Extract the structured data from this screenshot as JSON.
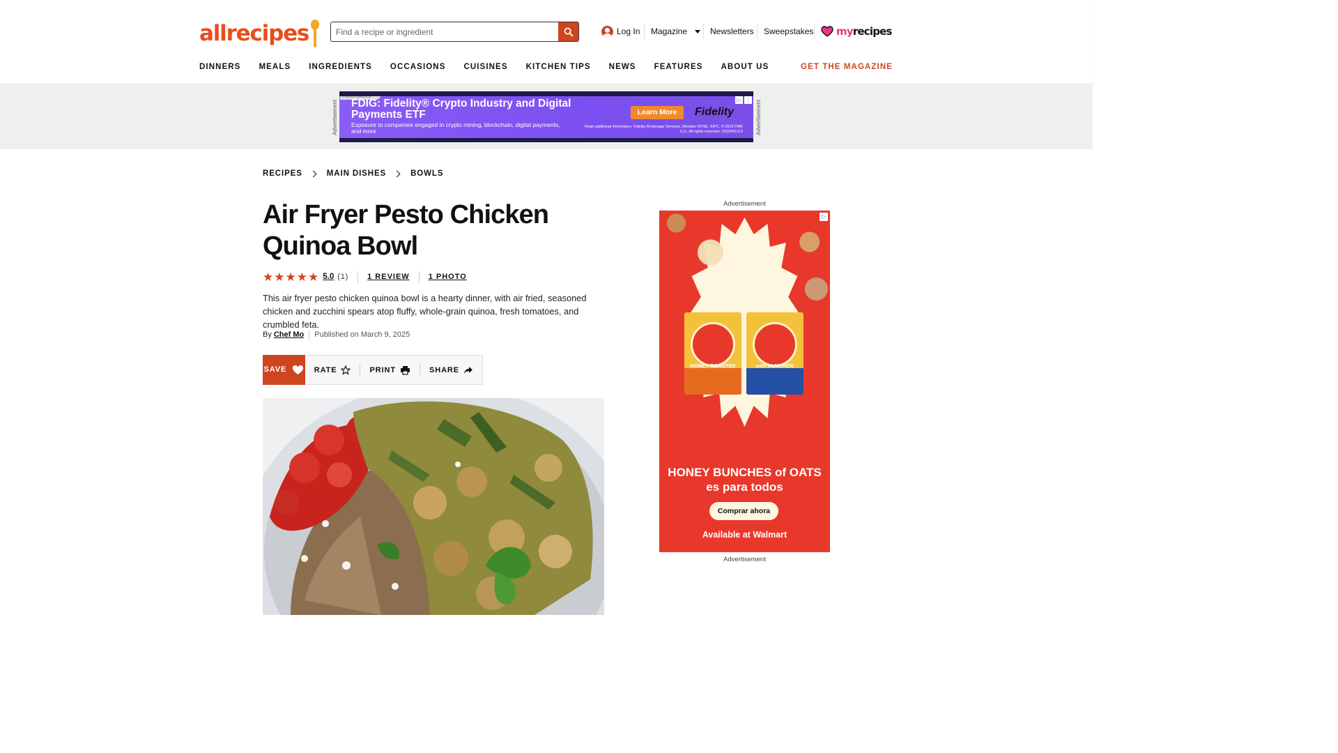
{
  "header": {
    "logo_text": "allrecipes",
    "search_placeholder": "Find a recipe or ingredient",
    "login_label": "Log In",
    "magazine_label": "Magazine",
    "newsletters_label": "Newsletters",
    "sweepstakes_label": "Sweepstakes",
    "myrecipes_my": "my",
    "myrecipes_recipes": "recipes",
    "brand_color": "#ce4620"
  },
  "nav": {
    "items": [
      {
        "label": "DINNERS"
      },
      {
        "label": "MEALS"
      },
      {
        "label": "INGREDIENTS"
      },
      {
        "label": "OCCASIONS"
      },
      {
        "label": "CUISINES"
      },
      {
        "label": "KITCHEN TIPS"
      },
      {
        "label": "NEWS"
      },
      {
        "label": "FEATURES"
      },
      {
        "label": "ABOUT US"
      }
    ],
    "get_magazine_label": "GET THE MAGAZINE"
  },
  "top_ad": {
    "side_label": "Advertisement",
    "adchoices_label": "AdChoices",
    "headline": "FDIG: Fidelity® Crypto Industry and Digital Payments ETF",
    "subtext": "Exposure to companies engaged in crypto mining, blockchain, digital payments, and more",
    "cta_label": "Learn More",
    "brand": "Fidelity",
    "fine_print": "Read additional information. Fidelity Brokerage Services, Member NYSE, SIPC. © 2023 FMR LLC. All rights reserved. 1022453.2.0"
  },
  "breadcrumb": {
    "items": [
      {
        "label": "RECIPES"
      },
      {
        "label": "MAIN DISHES"
      },
      {
        "label": "BOWLS"
      }
    ]
  },
  "recipe": {
    "title": "Air Fryer Pesto Chicken Quinoa Bowl",
    "rating_value": "5.0",
    "rating_count": "(1)",
    "rating_stars": 5,
    "reviews_label": "1 REVIEW",
    "photos_label": "1 PHOTO",
    "description": "This air fryer pesto chicken quinoa bowl is a hearty dinner, with air fried, seasoned chicken and zucchini spears atop fluffy, whole-grain quinoa, fresh tomatoes, and crumbled feta.",
    "by_label": "By",
    "author": "Chef Mo",
    "published": "Published on March 9, 2025"
  },
  "actions": {
    "save_label": "SAVE",
    "rate_label": "RATE",
    "print_label": "PRINT",
    "share_label": "SHARE"
  },
  "side_ad": {
    "label_top": "Advertisement",
    "label_bottom": "Advertisement",
    "box1_label": "HONEY ROASTED",
    "box2_label": "with ALMONDS",
    "headline_line1": "HONEY BUNCHES of OATS",
    "headline_line2": "es para todos",
    "cta_label": "Comprar ahora",
    "availability": "Available at Walmart"
  }
}
